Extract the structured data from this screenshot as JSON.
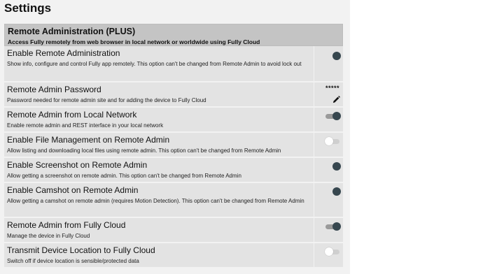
{
  "page": {
    "title": "Settings"
  },
  "section": {
    "title": "Remote Administration (PLUS)",
    "subtitle": "Access Fully remotely from web browser in local network or worldwide using Fully Cloud"
  },
  "settings": [
    {
      "title": "Enable Remote Administration",
      "desc": "Show info, configure and control Fully app remotely. This option can't be changed from Remote Admin to avoid lock out",
      "control": "knob",
      "enabled": true
    },
    {
      "title": "Remote Admin Password",
      "desc": "Password needed for remote admin site and for adding the device to Fully Cloud",
      "control": "password",
      "value": "*****",
      "icon": "pencil-icon"
    },
    {
      "title": "Remote Admin from Local Network",
      "desc": "Enable remote admin and REST interface in your local network",
      "control": "toggle",
      "enabled": true
    },
    {
      "title": "Enable File Management on Remote Admin",
      "desc": "Allow listing and downloading local files using remote admin. This option can't be changed from Remote Admin",
      "control": "toggle",
      "enabled": false
    },
    {
      "title": "Enable Screenshot on Remote Admin",
      "desc": "Allow getting a screenshot on remote admin. This option can't be changed from Remote Admin",
      "control": "knob",
      "enabled": true
    },
    {
      "title": "Enable Camshot on Remote Admin",
      "desc": "Allow getting a camshot on remote admin (requires Motion Detection). This option can't be changed from Remote Admin",
      "control": "knob",
      "enabled": true
    },
    {
      "title": "Remote Admin from Fully Cloud",
      "desc": "Manage the device in Fully Cloud",
      "control": "toggle",
      "enabled": true
    },
    {
      "title": "Transmit Device Location to Fully Cloud",
      "desc": "Switch off if device location is sensible/protected data",
      "control": "toggle",
      "enabled": false
    }
  ],
  "colors": {
    "knob": "#37474f",
    "header": "#c4c4c4",
    "row": "#e3e3e3"
  }
}
